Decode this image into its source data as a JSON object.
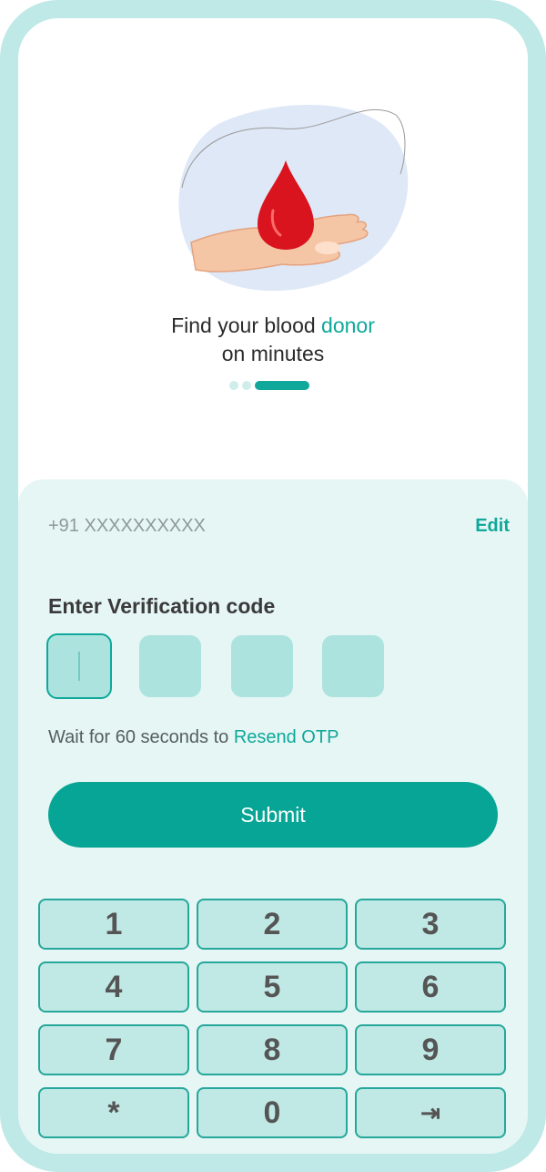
{
  "onboarding": {
    "headline_part1": "Find your blood ",
    "headline_accent": "donor",
    "headline_part2": "on minutes",
    "pager": {
      "count": 3,
      "active_index": 2
    }
  },
  "otp": {
    "phone_number": "+91  XXXXXXXXXX",
    "edit_label": "Edit",
    "title": "Enter Verification code",
    "digits": [
      "",
      "",
      "",
      ""
    ],
    "resend_prefix": "Wait for 60 seconds to ",
    "resend_link": "Resend OTP",
    "submit_label": "Submit"
  },
  "keypad": {
    "keys": [
      "1",
      "2",
      "3",
      "4",
      "5",
      "6",
      "7",
      "8",
      "9",
      "*",
      "0",
      "⇥"
    ]
  },
  "colors": {
    "accent": "#0fa89b",
    "button": "#07a595",
    "frame": "#bfe9e6",
    "panel": "#e5f6f4",
    "blood": "#d9141f"
  },
  "icons": {
    "illustration": "blood-drop-hand-illustration",
    "tab_key": "tab-arrow-icon"
  }
}
